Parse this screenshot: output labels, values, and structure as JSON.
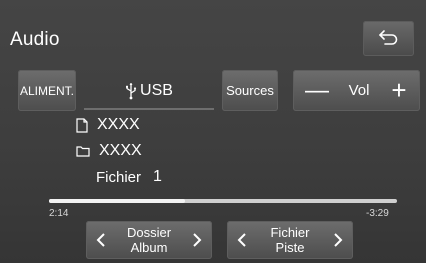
{
  "header": {
    "title": "Audio"
  },
  "controls": {
    "power_label": "ALIMENT.",
    "source_label": "USB",
    "sources_label": "Sources",
    "vol_minus": "—",
    "vol_label": "Vol",
    "vol_plus": "+"
  },
  "track": {
    "file_name": "XXXX",
    "folder_name": "XXXX",
    "fichier_label": "Fichier",
    "fichier_number": "1"
  },
  "progress": {
    "elapsed": "2:14",
    "remaining": "-3:29",
    "fraction": 0.39
  },
  "nav": {
    "folder_line1": "Dossier",
    "folder_line2": "Album",
    "file_line1": "Fichier",
    "file_line2": "Piste"
  },
  "icons": {
    "back": "back-arrow-icon",
    "usb": "usb-icon",
    "file": "file-icon",
    "folder": "folder-icon",
    "prev": "chevron-left-icon",
    "next": "chevron-right-icon"
  }
}
